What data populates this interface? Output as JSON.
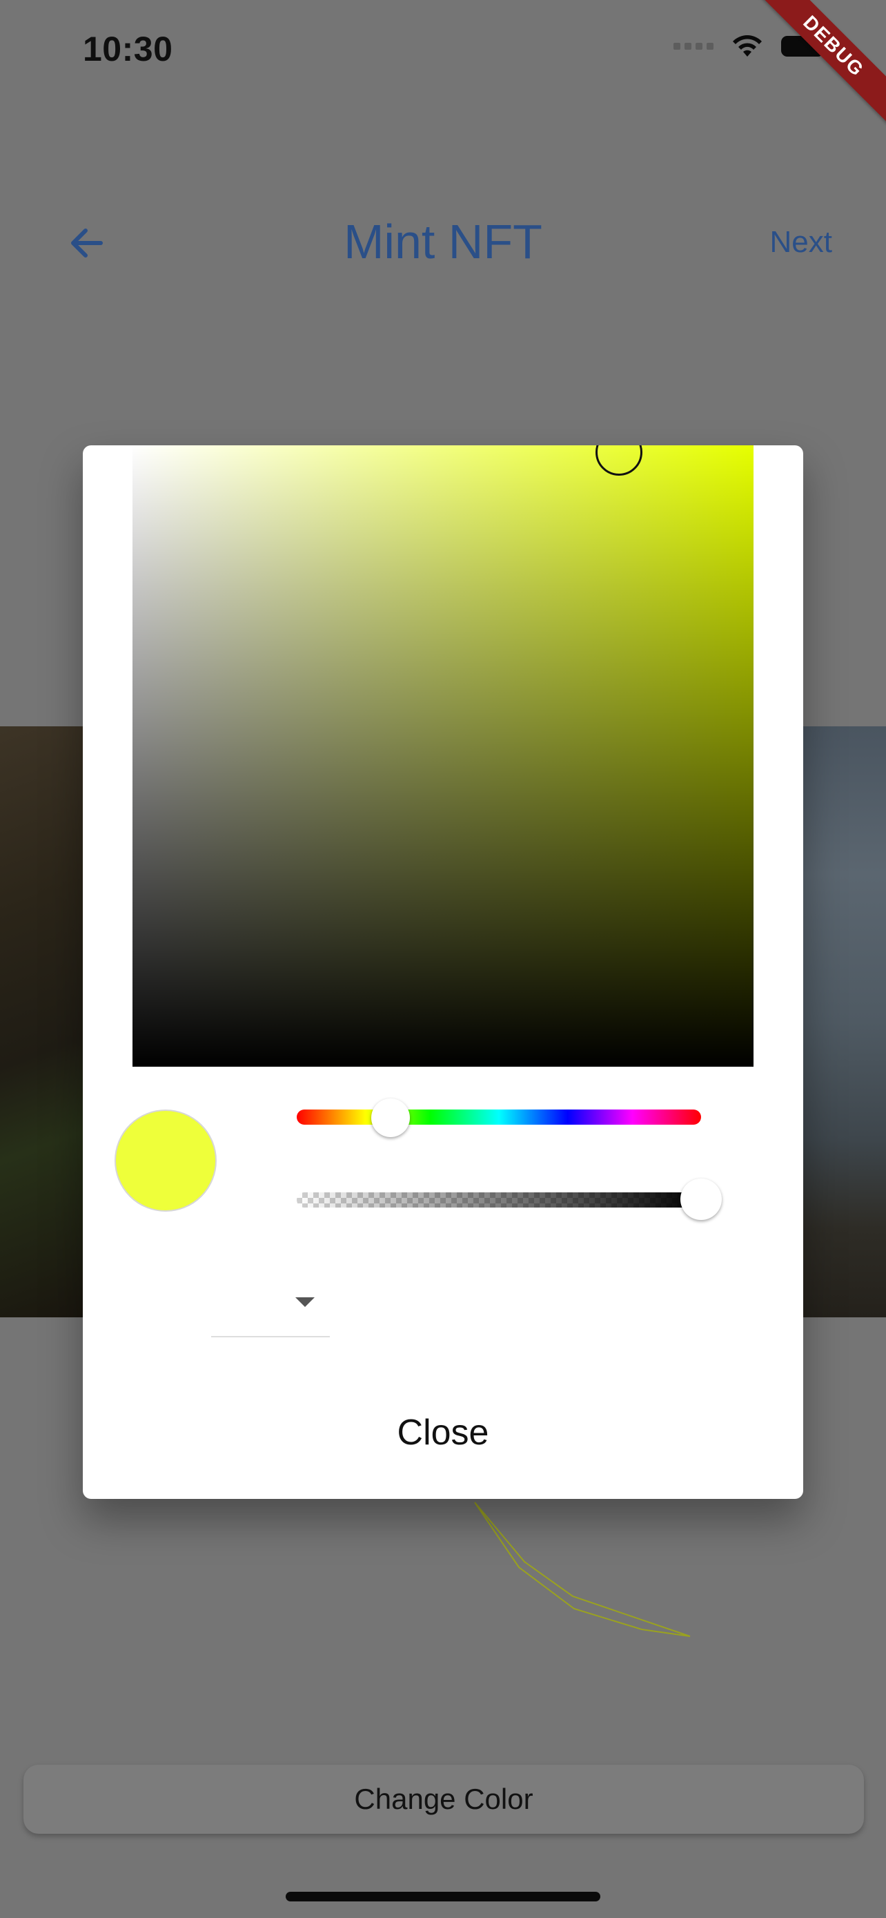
{
  "status_bar": {
    "time": "10:30"
  },
  "debug_banner": {
    "label": "DEBUG"
  },
  "app_bar": {
    "title": "Mint NFT",
    "next_label": "Next"
  },
  "color_picker": {
    "selected_color": "#EEFF3A",
    "hue_color": "#E6FF00",
    "alpha": 1.0,
    "close_label": "Close"
  },
  "bottom_button": {
    "label": "Change Color"
  },
  "stroke_color": "#9aa21f"
}
